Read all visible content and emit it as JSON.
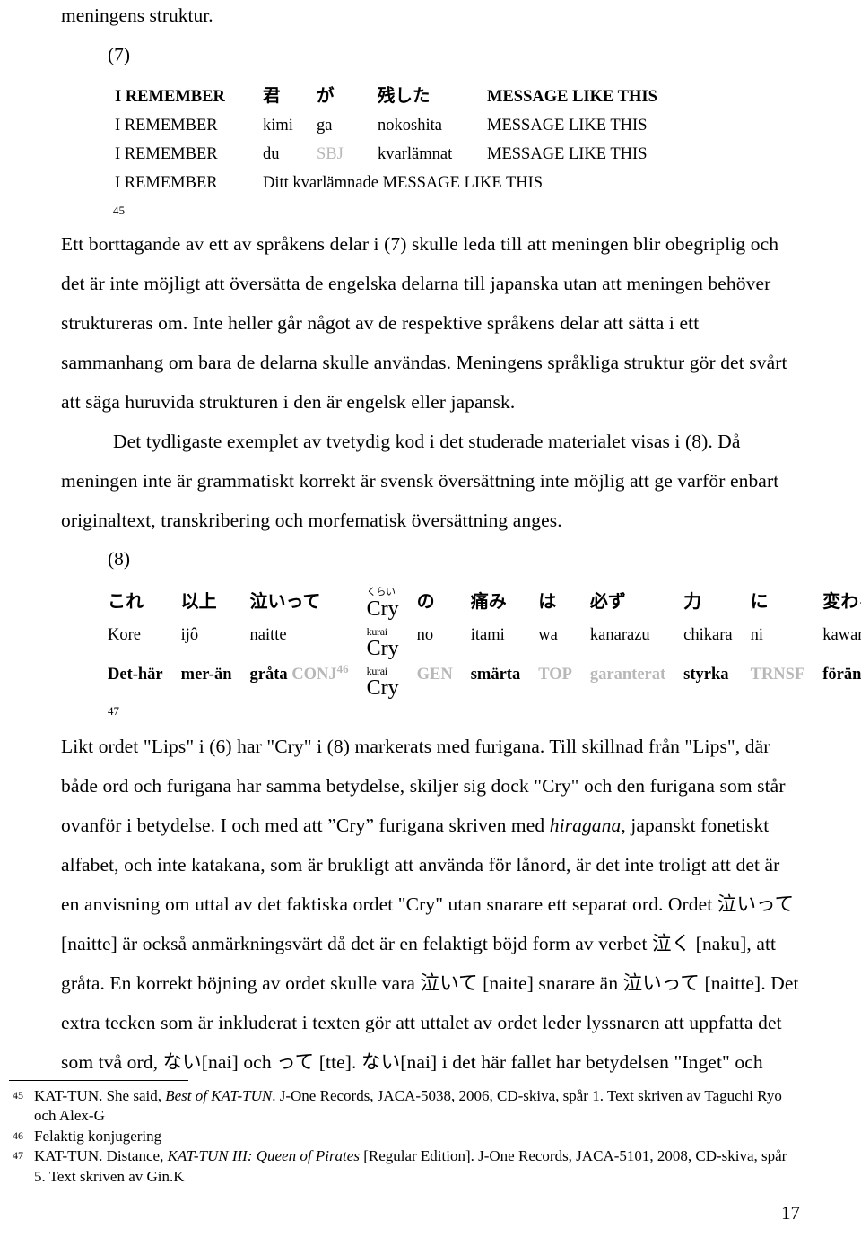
{
  "top_line": "meningens struktur.",
  "example7": {
    "label": "(7)",
    "columns": [
      "english",
      "w1",
      "w2",
      "w3",
      "english2"
    ],
    "rows": [
      {
        "style": "original",
        "cells": [
          "I REMEMBER",
          "君",
          "が",
          "残した",
          "MESSAGE LIKE THIS"
        ]
      },
      {
        "style": "romaji",
        "cells": [
          "I REMEMBER",
          "kimi",
          "ga",
          "nokoshita",
          "MESSAGE LIKE THIS"
        ]
      },
      {
        "style": "gloss",
        "cells": [
          "I REMEMBER",
          "du",
          "SBJ",
          "kvarlämnat",
          "MESSAGE LIKE THIS"
        ],
        "grey_cells": [
          2
        ]
      },
      {
        "style": "translation",
        "merged": true,
        "cells": [
          "I REMEMBER",
          "Ditt kvarlämnade MESSAGE LIKE THIS"
        ]
      }
    ],
    "footnote_ref": "45"
  },
  "paragraph1": "Ett borttagande av ett av språkens delar i (7) skulle leda till att meningen blir obegriplig och det är inte möjligt att översätta de engelska delarna till japanska utan att meningen behöver struktureras om. Inte heller går något av de respektive språkens delar att sätta i ett sammanhang om bara de delarna skulle användas. Meningens språkliga struktur gör det svårt att säga huruvida strukturen i den är engelsk eller japansk.",
  "paragraph2": "Det tydligaste exemplet av tvetydig kod i det studerade materialet visas i (8). Då meningen inte är grammatiskt korrekt är svensk översättning inte möjlig att ge varför enbart originaltext, transkribering och morfematisk översättning anges.",
  "example8": {
    "label": "(8)",
    "row_jp": [
      {
        "text": "これ"
      },
      {
        "text": "以上"
      },
      {
        "text": "泣いって"
      },
      {
        "ruby_top": "くらい",
        "ruby_base": "Cry",
        "is_ruby": true
      },
      {
        "text": "の"
      },
      {
        "text": "痛み"
      },
      {
        "text": "は"
      },
      {
        "text": "必ず"
      },
      {
        "text": "力"
      },
      {
        "text": "に"
      },
      {
        "text": "変わる"
      }
    ],
    "row_rom": [
      {
        "text": "Kore"
      },
      {
        "text": "ijô"
      },
      {
        "text": "naitte"
      },
      {
        "ruby_top": "kurai",
        "ruby_base": "Cry",
        "is_ruby": true
      },
      {
        "text": "no"
      },
      {
        "text": "itami"
      },
      {
        "text": "wa"
      },
      {
        "text": "kanarazu"
      },
      {
        "text": "chikara"
      },
      {
        "text": "ni"
      },
      {
        "text": "kawaru"
      }
    ],
    "row_sv": [
      {
        "text": "Det-här"
      },
      {
        "text": "mer-än"
      },
      {
        "text": "gråta",
        "suffix": "CONJ",
        "suffix_grey": true,
        "suffix_fn": "46"
      },
      {
        "ruby_top": "kurai",
        "ruby_base": "Cry",
        "is_ruby": true
      },
      {
        "text": "GEN",
        "grey": true
      },
      {
        "text": "smärta"
      },
      {
        "text": "TOP",
        "grey": true
      },
      {
        "text": "garanterat",
        "grey": true
      },
      {
        "text": "styrka"
      },
      {
        "text": "TRNSF",
        "grey": true
      },
      {
        "text": "förändras-till"
      }
    ],
    "footnote_ref": "47"
  },
  "paragraph3_a": "Likt ordet \"Lips\" i (6) har \"Cry\" i (8) markerats med furigana. Till skillnad från \"Lips\", där både ord och furigana har samma betydelse, skiljer sig dock \"Cry\" och den furigana som står ovanför i betydelse. I och med att ”Cry” furigana skriven med ",
  "paragraph3_italic": "hiragana",
  "paragraph3_b": ", japanskt fonetiskt alfabet, och inte katakana, som är brukligt att använda för lånord, är det inte troligt att det är en anvisning om uttal av det faktiska ordet \"Cry\" utan snarare ett separat ord. Ordet 泣いって [naitte] är också anmärkningsvärt då det är en felaktigt böjd form av verbet 泣く [naku], att gråta. En korrekt böjning av ordet skulle vara 泣いて [naite] snarare än 泣いって [naitte]. Det extra tecken som är inkluderat i texten gör att uttalet av ordet leder lyssnaren att uppfatta det som två ord, ない[nai] och って [tte]. ない[nai] i det här fallet har betydelsen \"Inget\" och",
  "footnotes": [
    {
      "number": "45",
      "parts": [
        {
          "text": "KAT-TUN. She said, ",
          "italic": false
        },
        {
          "text": "Best of KAT-TUN",
          "italic": true
        },
        {
          "text": ". J-One Records, JACA-5038, 2006, CD-skiva, spår 1. Text skriven av Taguchi Ryo och Alex-G",
          "italic": false
        }
      ]
    },
    {
      "number": "46",
      "parts": [
        {
          "text": "Felaktig konjugering",
          "italic": false
        }
      ]
    },
    {
      "number": "47",
      "parts": [
        {
          "text": "KAT-TUN. Distance, ",
          "italic": false
        },
        {
          "text": "KAT-TUN III: Queen of Pirates",
          "italic": true
        },
        {
          "text": " [Regular Edition]. J-One Records, JACA-5101, 2008, CD-skiva, spår 5. Text skriven av Gin.K",
          "italic": false
        }
      ]
    }
  ],
  "page_number": "17",
  "colors": {
    "grey_gloss": "#b8b8b8",
    "text": "#000000",
    "background": "#ffffff"
  }
}
